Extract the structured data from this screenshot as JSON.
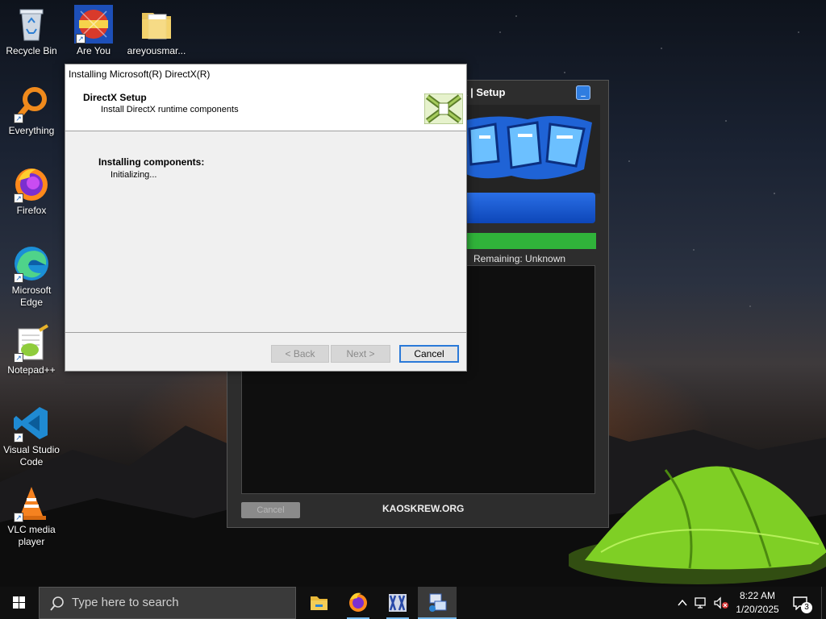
{
  "desktop": {
    "icons": [
      {
        "label": "Recycle Bin",
        "icon": "recycle-bin-icon"
      },
      {
        "label": "Are You",
        "icon": "are-you-smarter-icon"
      },
      {
        "label": "areyousmar...",
        "icon": "folder-icon"
      },
      {
        "label": "Everything",
        "icon": "everything-search-icon"
      },
      {
        "label": "Firefox",
        "icon": "firefox-icon"
      },
      {
        "label": "Microsoft Edge",
        "icon": "edge-icon"
      },
      {
        "label": "Notepad++",
        "icon": "notepadpp-icon"
      },
      {
        "label": "Visual Studio Code",
        "icon": "vscode-icon"
      },
      {
        "label": "VLC media player",
        "icon": "vlc-icon"
      }
    ]
  },
  "kaos_window": {
    "title_partial": "ck | Setup",
    "remaining": "Remaining: Unknown",
    "cancel_label": "Cancel",
    "site": "KAOSKREW.ORG",
    "minimize_glyph": "_"
  },
  "directx_dialog": {
    "title": "Installing Microsoft(R) DirectX(R)",
    "header_title": "DirectX Setup",
    "header_subtitle": "Install DirectX runtime components",
    "body_title": "Installing components:",
    "body_status": "Initializing...",
    "back_label": "< Back",
    "next_label": "Next >",
    "cancel_label": "Cancel"
  },
  "taskbar": {
    "search_placeholder": "Type here to search",
    "apps": [
      "file-explorer-icon",
      "firefox-icon",
      "kaoskrew-icon",
      "setup-icon"
    ],
    "time": "8:22 AM",
    "date": "1/20/2025",
    "notification_count": "3"
  },
  "colors": {
    "accent": "#2a79d8",
    "taskbar": "#101010",
    "progress_green": "#30b33a",
    "progress_blue": "#0d46b8"
  }
}
